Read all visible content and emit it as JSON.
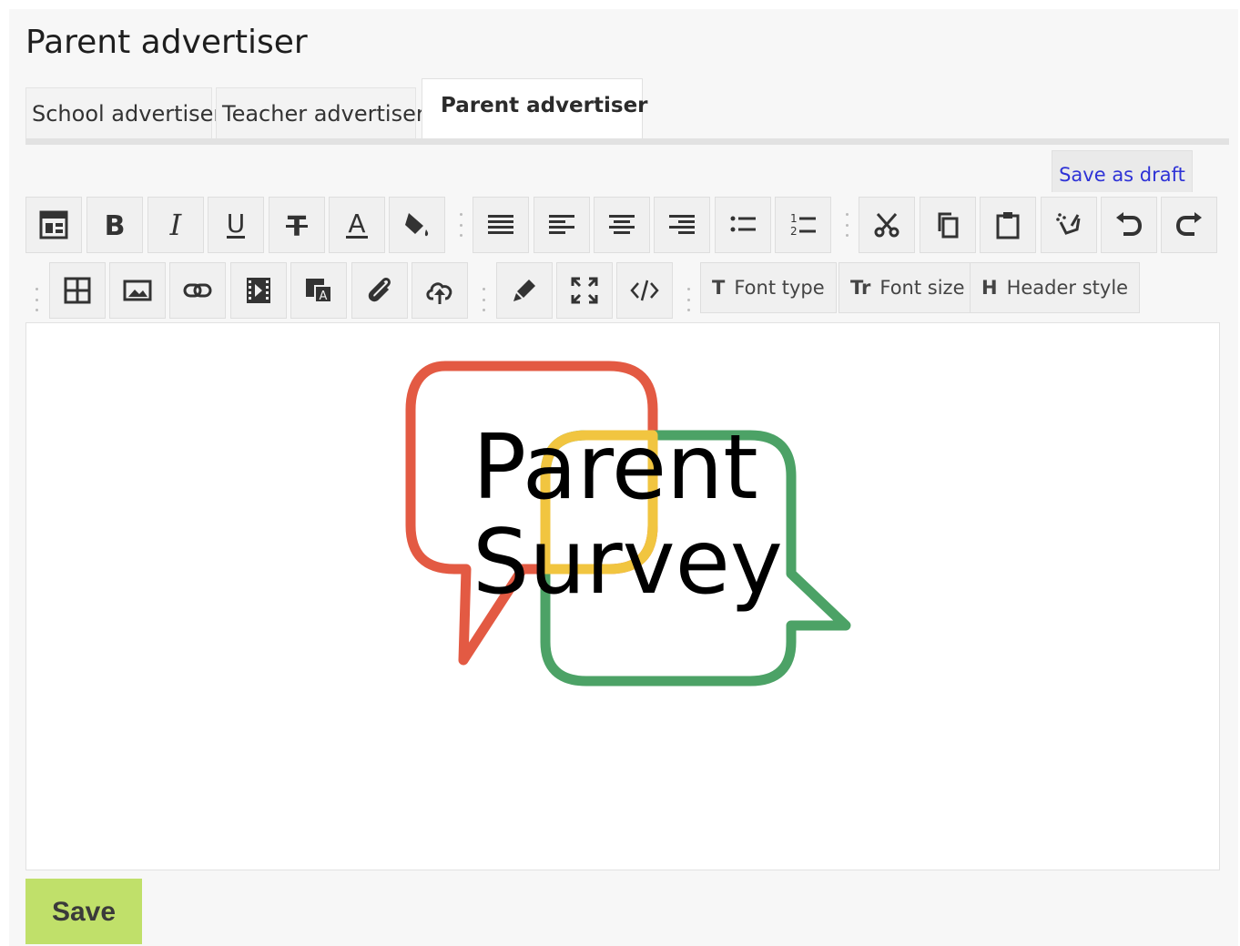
{
  "page": {
    "title": "Parent advertiser"
  },
  "tabs": [
    {
      "label": "School advertiser",
      "active": false
    },
    {
      "label": "Teacher advertiser",
      "active": false
    },
    {
      "label": "Parent advertiser",
      "active": true
    }
  ],
  "actions": {
    "save_draft": "Save as draft",
    "save": "Save"
  },
  "toolbar": {
    "row1": [
      "template-icon",
      "bold-icon",
      "italic-icon",
      "underline-icon",
      "strikethrough-icon",
      "font-color-icon",
      "fill-color-icon",
      "align-justify-icon",
      "align-left-icon",
      "align-center-icon",
      "align-right-icon",
      "bullet-list-icon",
      "numbered-list-icon",
      "cut-icon",
      "copy-icon",
      "paste-icon",
      "clear-format-icon",
      "undo-icon",
      "redo-icon"
    ],
    "row2": [
      "table-icon",
      "image-icon",
      "link-icon",
      "video-icon",
      "special-char-icon",
      "attachment-icon",
      "upload-icon",
      "highlight-icon",
      "fullscreen-icon",
      "code-icon"
    ],
    "font_type": "Font type",
    "font_size": "Font size",
    "header_style": "Header style",
    "font_type_glyph": "T",
    "font_size_glyph": "Tr",
    "header_style_glyph": "H"
  },
  "editor": {
    "logo": {
      "line1": "Parent",
      "line2": "Survey"
    },
    "colors": {
      "red": "#e35a43",
      "green": "#4ca266",
      "yellow": "#f1c540"
    }
  }
}
